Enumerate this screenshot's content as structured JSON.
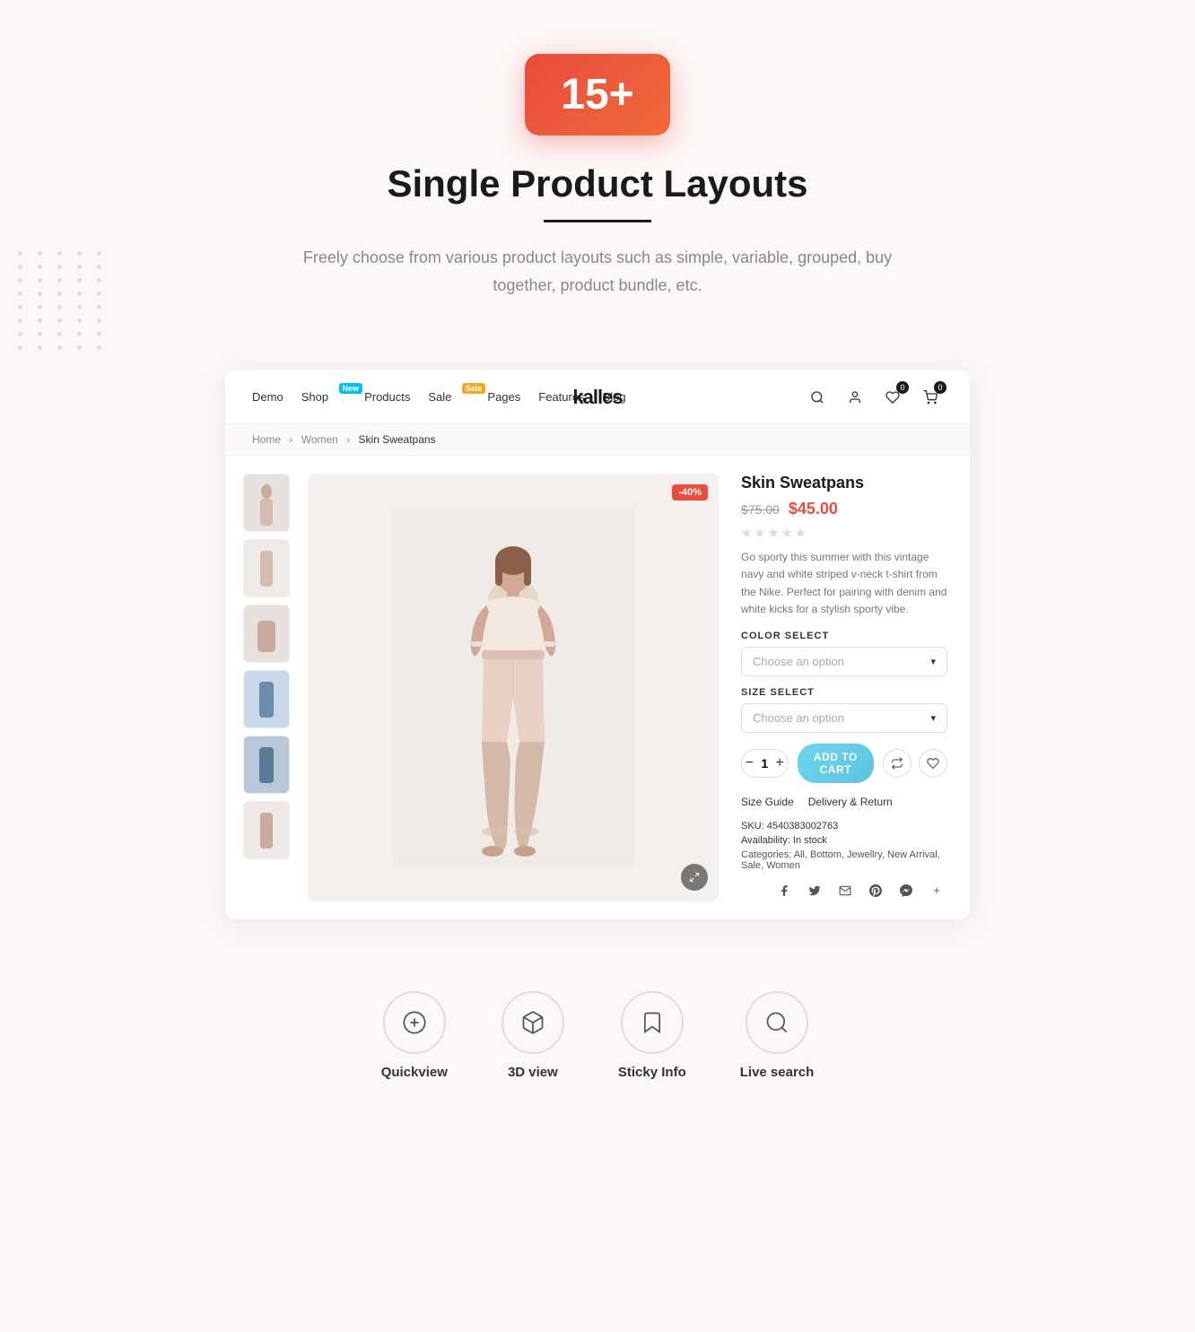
{
  "hero": {
    "badge": "15+",
    "title": "Single Product Layouts",
    "subtitle": "Freely choose from various product layouts such as simple, variable, grouped, buy together, product bundle, etc."
  },
  "nav": {
    "links": [
      {
        "label": "Demo",
        "badge": null
      },
      {
        "label": "Shop",
        "badge": "New"
      },
      {
        "label": "Products",
        "badge": null
      },
      {
        "label": "Sale",
        "badge": "Sale"
      },
      {
        "label": "Pages",
        "badge": null
      },
      {
        "label": "Features",
        "badge": null
      },
      {
        "label": "Blog",
        "badge": null
      }
    ],
    "logo": "kalles",
    "wishlist_count": "0",
    "cart_count": "0"
  },
  "breadcrumb": {
    "home": "Home",
    "women": "Women",
    "current": "Skin Sweatpans"
  },
  "product": {
    "name": "Skin Sweatpans",
    "price_old": "$75.00",
    "price_new": "$45.00",
    "discount": "-40%",
    "description": "Go sporty this summer with this vintage navy and white striped v-neck t-shirt from the Nike. Perfect for pairing with denim and white kicks for a stylish sporty vibe.",
    "color_label": "COLOR SELECT",
    "color_placeholder": "Choose an option",
    "size_label": "SIZE SELECT",
    "size_placeholder": "Choose an option",
    "quantity": "1",
    "add_to_cart": "ADD TO CART",
    "size_guide": "Size Guide",
    "delivery": "Delivery & Return",
    "sku_label": "SKU:",
    "sku_value": "4540383002763",
    "availability_label": "Availability:",
    "availability_value": "In stock",
    "categories_label": "Categories:",
    "categories_value": "All, Bottom, Jewellry, New Arrival, Sale, Women"
  },
  "features": [
    {
      "icon": "plus-circle",
      "label": "Quickview"
    },
    {
      "icon": "cube",
      "label": "3D view"
    },
    {
      "icon": "bookmark",
      "label": "Sticky Info"
    },
    {
      "icon": "search",
      "label": "Live search"
    }
  ]
}
